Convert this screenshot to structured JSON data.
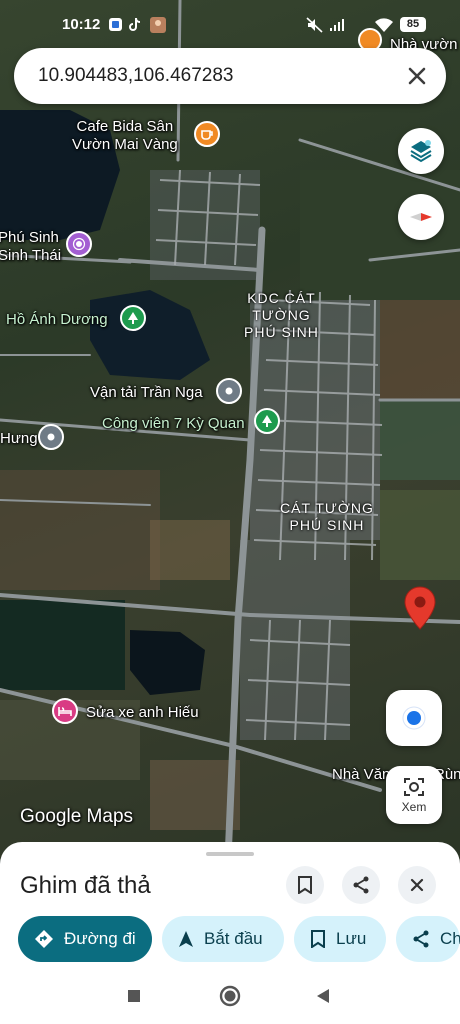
{
  "status_bar": {
    "time": "10:12",
    "battery": "85"
  },
  "search": {
    "query": "10.904483,106.467283"
  },
  "map": {
    "labels": {
      "cafe": "Cafe Bida Sân\nVườn Mai Vàng",
      "nha_vuon": "Nhà vườn",
      "phu_sinh": "Phú Sinh\nSinh Thái",
      "ho_anh_duong": "Hồ Ánh Dương",
      "kdc": "KDC CÁT\nTƯỜNG\nPHÚ SINH",
      "van_tai": "Vận tải Trần Nga",
      "cong_vien": "Công viên 7 Kỳ Quan",
      "hung": "Hưng",
      "cat_tuong": "CÁT TƯỜNG\nPHÚ SINH",
      "sua_xe": "Sửa xe anh Hiếu",
      "nha_van": "Nhà Văn",
      "run": "Rùn"
    },
    "google_logo": "Google Maps",
    "xem_label": "Xem"
  },
  "sheet": {
    "title": "Ghim đã thả",
    "chips": {
      "directions": "Đường đi",
      "start": "Bắt đầu",
      "save": "Lưu",
      "share": "Ch"
    }
  },
  "colors": {
    "primary_chip": "#0b6d80",
    "secondary_chip": "#d5f2fb",
    "pin": "#e5392c",
    "location_dot": "#1a73e8"
  },
  "icons": {
    "layers": "layers-icon",
    "compass": "compass-icon",
    "location": "my-location-icon",
    "lens": "lens-icon"
  }
}
